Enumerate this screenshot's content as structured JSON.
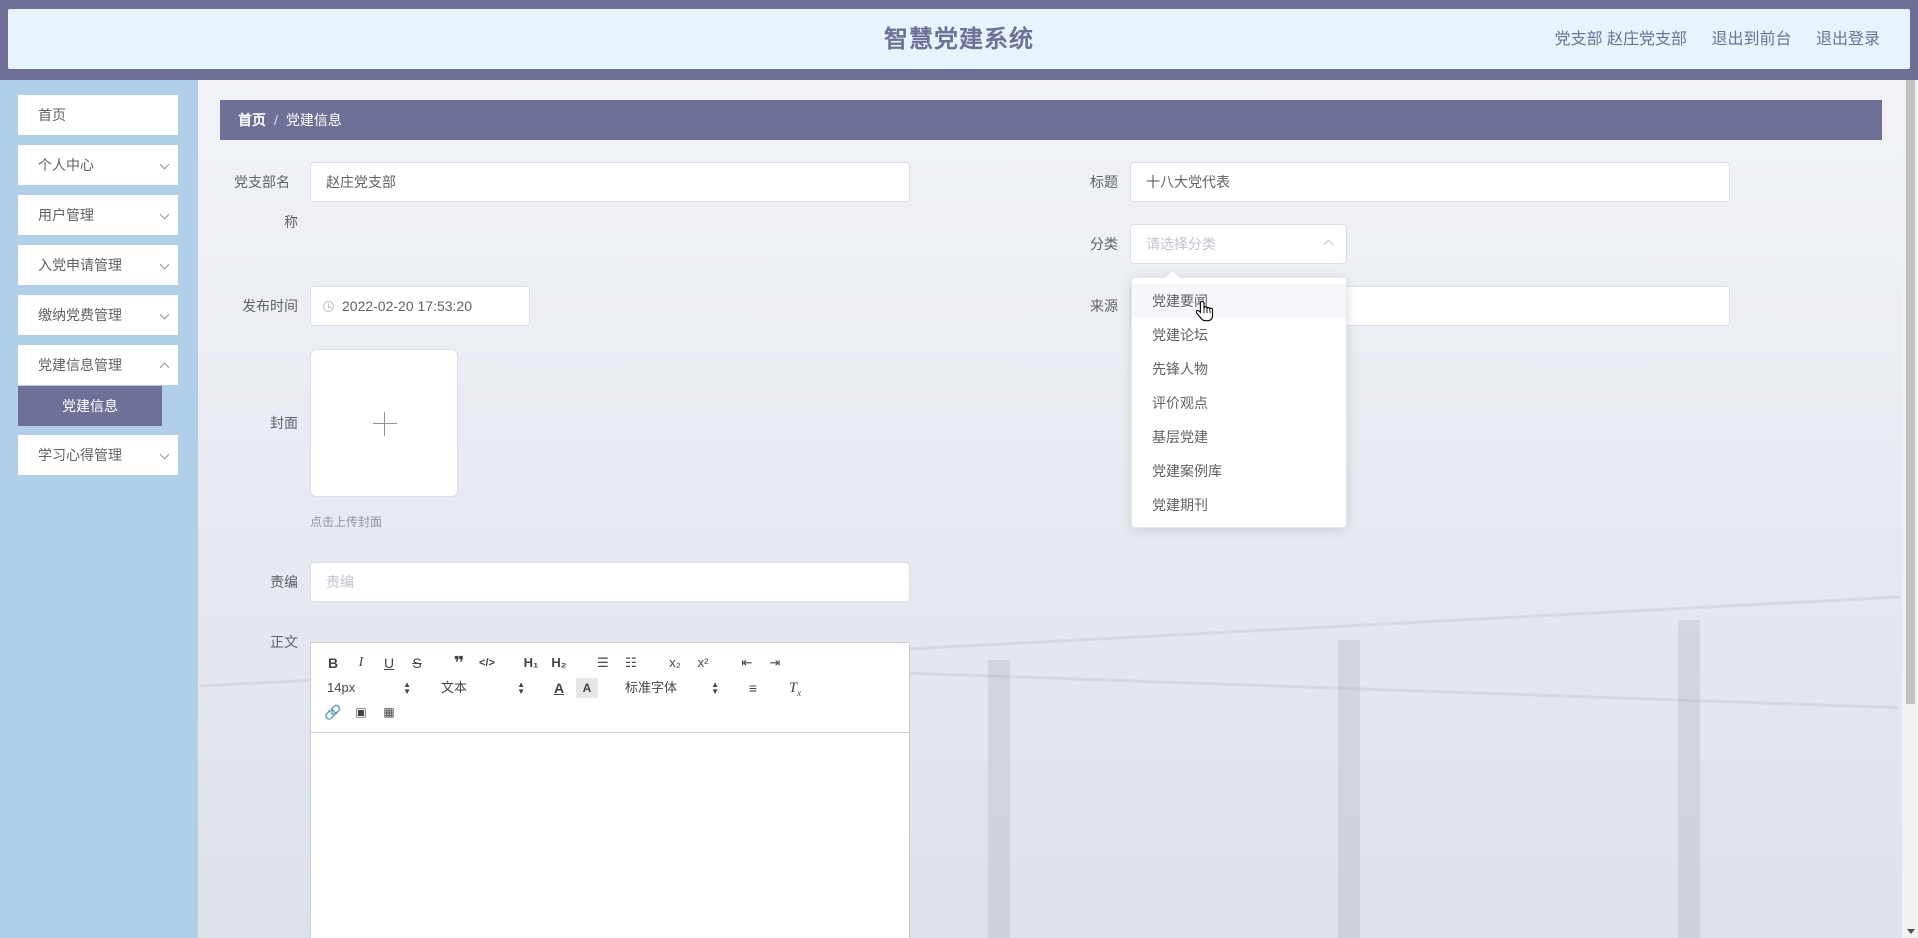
{
  "header": {
    "title": "智慧党建系统",
    "branch": "党支部 赵庄党支部",
    "to_front": "退出到前台",
    "logout": "退出登录"
  },
  "sidebar": {
    "items": [
      {
        "label": "首页"
      },
      {
        "label": "个人中心"
      },
      {
        "label": "用户管理"
      },
      {
        "label": "入党申请管理"
      },
      {
        "label": "缴纳党费管理"
      },
      {
        "label": "党建信息管理"
      },
      {
        "label": "学习心得管理"
      }
    ],
    "active_sub": "党建信息"
  },
  "breadcrumb": {
    "home": "首页",
    "separator": "/",
    "current": "党建信息"
  },
  "form": {
    "branch_label_line1": "党支部名",
    "branch_label_line2": "称",
    "branch_value": "赵庄党支部",
    "title_label": "标题",
    "title_value": "十八大党代表",
    "category_label": "分类",
    "category_placeholder": "请选择分类",
    "publish_label": "发布时间",
    "publish_value": "2022-02-20 17:53:20",
    "source_label": "来源",
    "cover_label": "封面",
    "cover_hint": "点击上传封面",
    "editor_label": "责编",
    "editor_placeholder": "责编",
    "body_label": "正文"
  },
  "toolbar": {
    "font_size": "14px",
    "header_select": "文本",
    "font_family": "标准字体"
  },
  "dropdown": {
    "options": [
      "党建要闻",
      "党建论坛",
      "先锋人物",
      "评价观点",
      "基层党建",
      "党建案例库",
      "党建期刊"
    ],
    "hovered_index": 0
  },
  "colors": {
    "accent": "#6f7097",
    "sidebar_bg": "#b2cfea",
    "header_bg": "#e7f4fc"
  }
}
